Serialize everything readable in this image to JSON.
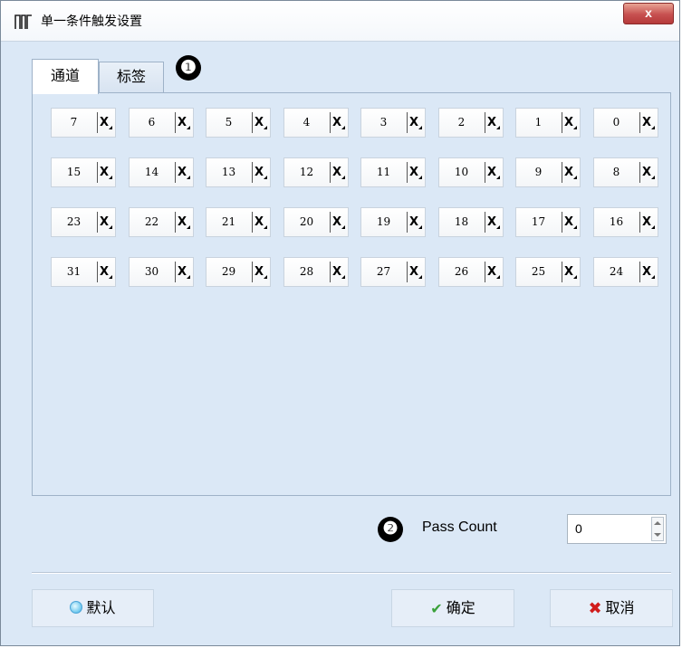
{
  "window": {
    "title": "单一条件触发设置",
    "close_label": "x"
  },
  "tabs": [
    {
      "label": "通道"
    },
    {
      "label": "标签"
    }
  ],
  "markers": [
    "❶",
    "❷"
  ],
  "channels": {
    "rows": [
      [
        {
          "num": "7",
          "val": "X"
        },
        {
          "num": "6",
          "val": "X"
        },
        {
          "num": "5",
          "val": "X"
        },
        {
          "num": "4",
          "val": "X"
        },
        {
          "num": "3",
          "val": "X"
        },
        {
          "num": "2",
          "val": "X"
        },
        {
          "num": "1",
          "val": "X"
        },
        {
          "num": "0",
          "val": "X"
        }
      ],
      [
        {
          "num": "15",
          "val": "X"
        },
        {
          "num": "14",
          "val": "X"
        },
        {
          "num": "13",
          "val": "X"
        },
        {
          "num": "12",
          "val": "X"
        },
        {
          "num": "11",
          "val": "X"
        },
        {
          "num": "10",
          "val": "X"
        },
        {
          "num": "9",
          "val": "X"
        },
        {
          "num": "8",
          "val": "X"
        }
      ],
      [
        {
          "num": "23",
          "val": "X"
        },
        {
          "num": "22",
          "val": "X"
        },
        {
          "num": "21",
          "val": "X"
        },
        {
          "num": "20",
          "val": "X"
        },
        {
          "num": "19",
          "val": "X"
        },
        {
          "num": "18",
          "val": "X"
        },
        {
          "num": "17",
          "val": "X"
        },
        {
          "num": "16",
          "val": "X"
        }
      ],
      [
        {
          "num": "31",
          "val": "X"
        },
        {
          "num": "30",
          "val": "X"
        },
        {
          "num": "29",
          "val": "X"
        },
        {
          "num": "28",
          "val": "X"
        },
        {
          "num": "27",
          "val": "X"
        },
        {
          "num": "26",
          "val": "X"
        },
        {
          "num": "25",
          "val": "X"
        },
        {
          "num": "24",
          "val": "X"
        }
      ]
    ]
  },
  "pass_count": {
    "label": "Pass Count",
    "value": "0"
  },
  "buttons": {
    "default": "默认",
    "ok": "确定",
    "cancel": "取消"
  },
  "icons": {
    "app": "logic-analyzer-icon",
    "default": "radio-dot-icon",
    "ok": "check-icon",
    "cancel": "x-icon"
  }
}
